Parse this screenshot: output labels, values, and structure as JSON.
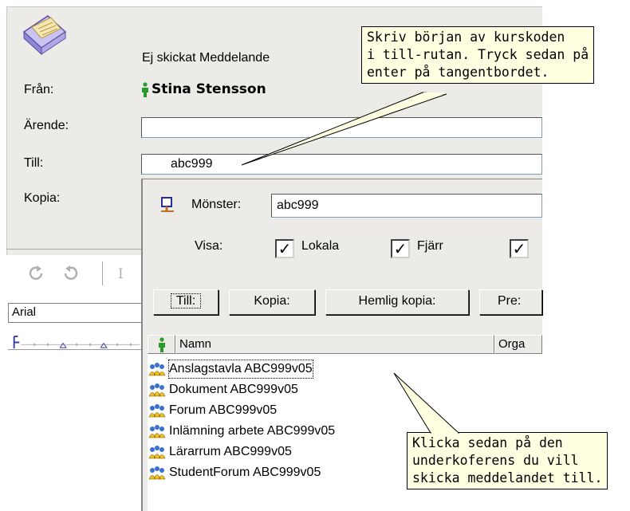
{
  "header": {
    "status_text": "Ej skickat Meddelande",
    "from_label": "Från:",
    "from_value": "Stina Stensson",
    "subject_label": "Ärende:",
    "to_label": "Till:",
    "to_value": "abc999",
    "cc_label": "Kopia:"
  },
  "editor": {
    "font_value": "Arial"
  },
  "popup": {
    "pattern_label": "Mönster:",
    "pattern_value": "abc999",
    "show_label": "Visa:",
    "show_local": "Lokala",
    "show_remote": "Fjärr",
    "buttons": {
      "to": "Till:",
      "cc": "Kopia:",
      "bcc": "Hemlig kopia:",
      "partial": "Pre:"
    },
    "columns": {
      "name": "Namn",
      "org": "Orga"
    },
    "items": [
      "Anslagstavla ABC999v05",
      "Dokument ABC999v05",
      "Forum ABC999v05",
      "Inlämning arbete ABC999v05",
      "Lärarrum ABC999v05",
      "StudentForum ABC999v05"
    ]
  },
  "callouts": {
    "top": "Skriv början av kurskoden\ni till-rutan. Tryck sedan på\nenter på tangentbordet.",
    "bottom": "Klicka sedan på den\nunderkoferens du vill\nskicka meddelandet till."
  },
  "colors": {
    "panel": "#ecebe8",
    "callout_bg": "#ffffe1",
    "person_icon": "#2a9a2a",
    "group_icon": "#3a6fd0"
  }
}
